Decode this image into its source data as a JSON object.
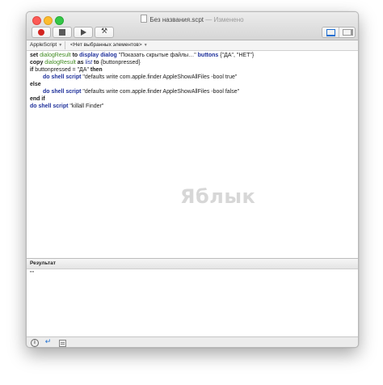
{
  "window": {
    "title": "Без названия.scpt",
    "separator": "—",
    "status": "Изменено"
  },
  "toolbar": {
    "record_icon": "record-icon",
    "stop_icon": "stop-icon",
    "run_icon": "play-icon",
    "compile_icon": "hammer-icon",
    "hammer_glyph": "⚒",
    "view_icons": [
      "editor-view-icon",
      "sidebar-view-icon"
    ]
  },
  "navbar": {
    "language": "AppleScript",
    "elements": "<Нет выбранных элементов>"
  },
  "code": {
    "l1": {
      "set": "set",
      "dialogResult": "dialogResult",
      "to": "to",
      "display_dialog": "display dialog",
      "string": "\"Показать скрытые файлы…\"",
      "buttons": "buttons",
      "list": "{\"ДА\", \"НЕТ\"}"
    },
    "l2": {
      "copy": "copy",
      "var": "dialogResult",
      "as": "as",
      "list": "list",
      "to": "to",
      "target": "{buttonpressed}"
    },
    "l3": {
      "if": "if",
      "cond": "buttonpressed = \"ДА\"",
      "then": "then"
    },
    "l4": {
      "cmd": "do shell script",
      "arg": "\"defaults write com.apple.finder AppleShowAllFiles -bool true\""
    },
    "l5": {
      "else": "else"
    },
    "l6": {
      "cmd": "do shell script",
      "arg": "\"defaults write com.apple.finder AppleShowAllFiles -bool false\""
    },
    "l7": {
      "end_if": "end if"
    },
    "l8": {
      "cmd": "do shell script",
      "arg": "\"killall Finder\""
    }
  },
  "watermark": "Яблык",
  "result": {
    "header": "Результат",
    "value": "\"\""
  },
  "bottombar": {
    "info_glyph": "i",
    "reply_glyph": "↵",
    "icons": [
      "info-icon",
      "reply-icon",
      "event-log-icon"
    ]
  }
}
